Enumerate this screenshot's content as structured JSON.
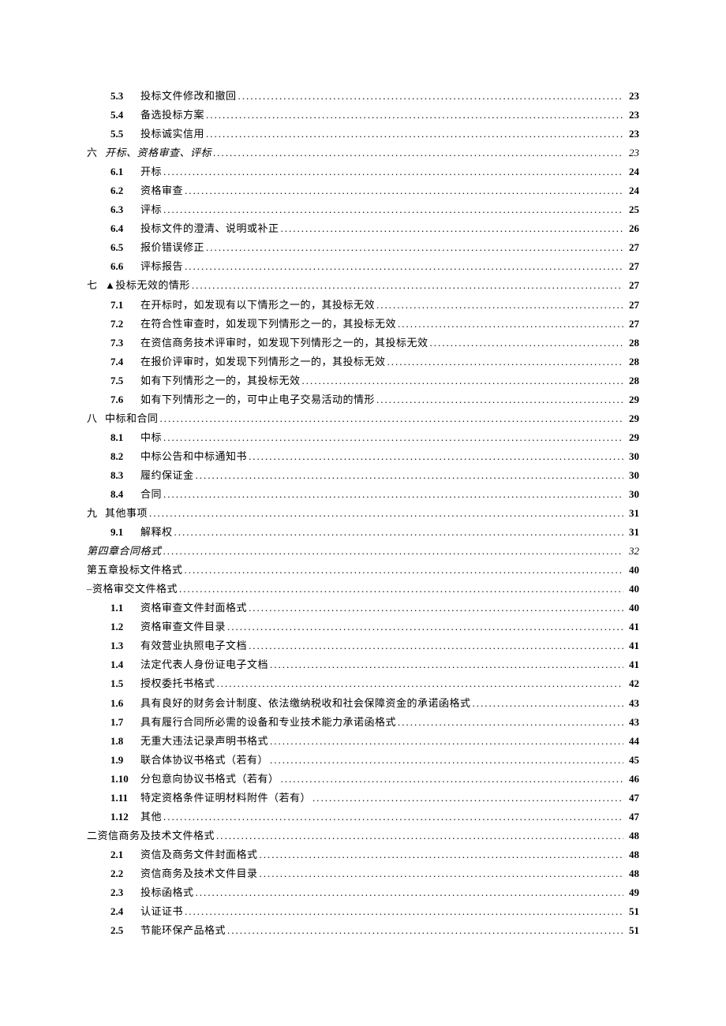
{
  "entries": [
    {
      "lvl": "sub",
      "num": "5.3",
      "title": "投标文件修改和撤回",
      "page": "23"
    },
    {
      "lvl": "sub",
      "num": "5.4",
      "title": "备选投标方案",
      "page": "23"
    },
    {
      "lvl": "sub",
      "num": "5.5",
      "title": "投标诚实信用",
      "page": "23"
    },
    {
      "lvl": "chp",
      "num": "六",
      "title": "开标、资格审查、评标",
      "page": "23",
      "italic": true
    },
    {
      "lvl": "sub",
      "num": "6.1",
      "title": "开标",
      "page": "24"
    },
    {
      "lvl": "sub",
      "num": "6.2",
      "title": "资格审查",
      "page": "24"
    },
    {
      "lvl": "sub",
      "num": "6.3",
      "title": "评标",
      "page": "25"
    },
    {
      "lvl": "sub",
      "num": "6.4",
      "title": "投标文件的澄清、说明或补正",
      "page": "26"
    },
    {
      "lvl": "sub",
      "num": "6.5",
      "title": "报价错误修正",
      "page": "27"
    },
    {
      "lvl": "sub",
      "num": "6.6",
      "title": "评标报告",
      "page": "27"
    },
    {
      "lvl": "chp",
      "num": "七",
      "title": "▲投标无效的情形",
      "page": "27"
    },
    {
      "lvl": "sub",
      "num": "7.1",
      "title": "在开标时，如发现有以下情形之一的，其投标无效",
      "page": "27"
    },
    {
      "lvl": "sub",
      "num": "7.2",
      "title": "在符合性审查时，如发现下列情形之一的，其投标无效",
      "page": "27"
    },
    {
      "lvl": "sub",
      "num": "7.3",
      "title": "在资信商务技术评审时，如发现下列情形之一的，其投标无效",
      "page": "28"
    },
    {
      "lvl": "sub",
      "num": "7.4",
      "title": "在报价评审时，如发现下列情形之一的，其投标无效",
      "page": "28"
    },
    {
      "lvl": "sub",
      "num": "7.5",
      "title": "如有下列情形之一的，其投标无效",
      "page": "28"
    },
    {
      "lvl": "sub",
      "num": "7.6",
      "title": "如有下列情形之一的，可中止电子交易活动的情形",
      "page": "29"
    },
    {
      "lvl": "chp",
      "num": "八",
      "title": "中标和合同",
      "page": "29"
    },
    {
      "lvl": "sub",
      "num": "8.1",
      "title": "中标",
      "page": "29"
    },
    {
      "lvl": "sub",
      "num": "8.2",
      "title": "中标公告和中标通知书",
      "page": "30"
    },
    {
      "lvl": "sub",
      "num": "8.3",
      "title": "履约保证金",
      "page": "30"
    },
    {
      "lvl": "sub",
      "num": "8.4",
      "title": "合同",
      "page": "30"
    },
    {
      "lvl": "chp",
      "num": "九",
      "title": "其他事项",
      "page": "31"
    },
    {
      "lvl": "sub",
      "num": "9.1",
      "title": "解释权",
      "page": "31"
    },
    {
      "lvl": "top",
      "title": "第四章合同格式",
      "page": "32",
      "italic": true
    },
    {
      "lvl": "top",
      "title": "第五章投标文件格式",
      "page": "40"
    },
    {
      "lvl": "top",
      "title": "–资格审交文件格式",
      "page": "40"
    },
    {
      "lvl": "sub",
      "num": "1.1",
      "title": "资格审查文件封面格式",
      "page": "40"
    },
    {
      "lvl": "sub",
      "num": "1.2",
      "title": "资格审查文件目录",
      "page": "41"
    },
    {
      "lvl": "sub",
      "num": "1.3",
      "title": "有效营业执照电子文档",
      "page": "41"
    },
    {
      "lvl": "sub",
      "num": "1.4",
      "title": "法定代表人身份证电子文档",
      "page": "41"
    },
    {
      "lvl": "sub",
      "num": "1.5",
      "title": "授权委托书格式",
      "page": "42"
    },
    {
      "lvl": "sub",
      "num": "1.6",
      "title": "具有良好的财务会计制度、依法缴纳税收和社会保障资金的承诺函格式",
      "page": "43"
    },
    {
      "lvl": "sub",
      "num": "1.7",
      "title": "具有履行合同所必需的设备和专业技术能力承诺函格式",
      "page": "43"
    },
    {
      "lvl": "sub",
      "num": "1.8",
      "title": "无重大违法记录声明书格式",
      "page": "44"
    },
    {
      "lvl": "sub",
      "num": "1.9",
      "title": "联合体协议书格式（若有）",
      "page": "45"
    },
    {
      "lvl": "sub",
      "num": "1.10",
      "title": "分包意向协议书格式（若有）",
      "page": "46"
    },
    {
      "lvl": "sub",
      "num": "1.11",
      "title": "特定资格条件证明材料附件（若有）",
      "page": "47"
    },
    {
      "lvl": "sub",
      "num": "1.12",
      "title": "其他",
      "page": "47"
    },
    {
      "lvl": "top",
      "title": "二资信商务及技术文件格式",
      "page": "48"
    },
    {
      "lvl": "sub",
      "num": "2.1",
      "title": "资信及商务文件封面格式",
      "page": "48"
    },
    {
      "lvl": "sub",
      "num": "2.2",
      "title": "资信商务及技术文件目录",
      "page": "48"
    },
    {
      "lvl": "sub",
      "num": "2.3",
      "title": "投标函格式",
      "page": "49"
    },
    {
      "lvl": "sub",
      "num": "2.4",
      "title": "认证证书",
      "page": "51"
    },
    {
      "lvl": "sub",
      "num": "2.5",
      "title": "节能环保产品格式",
      "page": "51"
    }
  ]
}
